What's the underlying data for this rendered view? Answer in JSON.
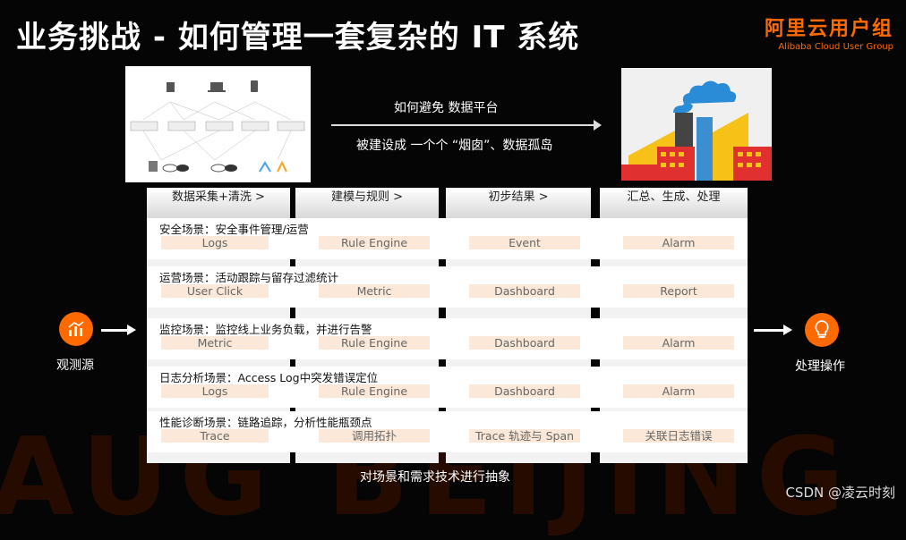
{
  "header": {
    "title": "业务挑战 - 如何管理一套复杂的 IT 系统",
    "brand_name": "阿里云用户组",
    "brand_sub": "Alibaba Cloud User Group"
  },
  "middle": {
    "line1": "如何避免 数据平台",
    "line2": "被建设成 一个个 “烟囱”、数据孤岛"
  },
  "table": {
    "columns": [
      "数据采集+清洗 >",
      "建模与规则 >",
      "初步结果 >",
      "汇总、生成、处理"
    ],
    "rows": [
      {
        "title": "安全场景：安全事件管理/运营",
        "cells": [
          "Logs",
          "Rule Engine",
          "Event",
          "Alarm"
        ]
      },
      {
        "title": "运营场景：活动跟踪与留存过滤统计",
        "cells": [
          "User Click",
          "Metric",
          "Dashboard",
          "Report"
        ]
      },
      {
        "title": "监控场景：监控线上业务负载，并进行告警",
        "cells": [
          "Metric",
          "Rule Engine",
          "Dashboard",
          "Alarm"
        ]
      },
      {
        "title": "日志分析场景：Access Log中突发错误定位",
        "cells": [
          "Logs",
          "Rule Engine",
          "Dashboard",
          "Alarm"
        ]
      },
      {
        "title": "性能诊断场景：链路追踪，分析性能瓶颈点",
        "cells": [
          "Trace",
          "调用拓扑",
          "Trace 轨迹与 Span",
          "关联日志错误"
        ]
      }
    ]
  },
  "side": {
    "source_label": "观测源",
    "dest_label": "处理操作"
  },
  "bottom_caption": "对场景和需求技术进行抽象",
  "watermark": "AUG BEIJING",
  "credit": "CSDN @凌云时刻",
  "colors": {
    "accent": "#ff6a00",
    "cell": "#fbe8d8"
  }
}
